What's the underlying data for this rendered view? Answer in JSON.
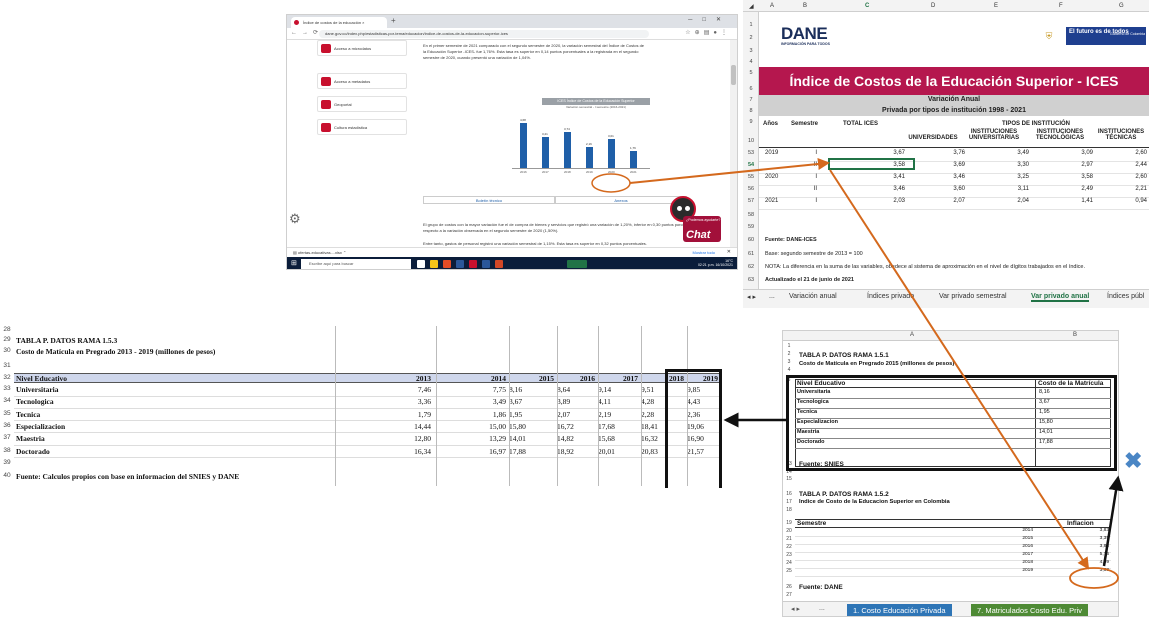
{
  "browser": {
    "tab_title": "Índice de costos de la educación ×",
    "new_tab": "+",
    "url": "dane.gov.co/index.php/estadisticas-por-tema/educacion/indice-de-costos-de-la-educacion-superior-ices",
    "sidebar_items": [
      "Acceso a microdatos",
      "Acceso a metadatos",
      "Geoportal",
      "Cultura estadística"
    ],
    "intro_text": "En el primer semestre de 2021 comparado con el segundo semestre de 2020, la variación semestral del Índice de Costos de la Educación Superior -ICES- fue 1,76%. Esta tasa es superior en 0,14 puntos porcentuales a la registrada en el segundo semestre de 2020, cuando presentó una variación de 1,04%.",
    "chart_title": "ICES Índice de Costos de la Educación Superior",
    "chart_subtitle": "Variación semestral - I semestre (2016-2021)",
    "tab_boletin": "Boletín técnico",
    "tab_anexos": "Anexos",
    "paragraph": "El grupo de costos con la mayor variación fue el de compra de bienes y servicios que registró una variación de 1,20%, inferior en 0,30 puntos porcentuales con respecto a la variación observada en el segundo semestre de 2020 (1,50%).",
    "paragraph2": "Entre tanto, gastos de personal registró una variación semestral de 1,15%. Esta tasa es superior en 0,32 puntos porcentuales.",
    "chat_question": "¿Podemos ayudarte?",
    "chat_label": "Chat",
    "download_file": "ofertas-educativas....xlsx",
    "download_show_all": "Mostrar todo",
    "taskbar_search": "Escribe aquí para buscar",
    "tray_text": "16°C",
    "clock": "02:21 p.m. 16/10/2021"
  },
  "mini_chart": {
    "type": "bar",
    "categories": [
      "2016",
      "2017",
      "2018",
      "2019",
      "2020",
      "2021"
    ],
    "values": [
      4.68,
      3.21,
      3.74,
      2.16,
      3.01,
      1.76
    ]
  },
  "xl1": {
    "columns": [
      "A",
      "B",
      "C",
      "D",
      "E",
      "F",
      "G"
    ],
    "logo": "DANE",
    "logo_sub": "INFORMACIÓN PARA TODOS",
    "gov_text": "El futuro es de todos",
    "gov_sub": "Gobierno de Colombia",
    "title": "Índice de Costos de la Educación Superior - ICES",
    "subtitle1": "Variación Anual",
    "subtitle2": "Privada por tipos de institución 1998 - 2021",
    "headers": {
      "anios": "Años",
      "semestre": "Semestre",
      "total": "TOTAL ICES",
      "tipos": "TIPOS DE INSTITUCIÓN",
      "univ": "UNIVERSIDADES",
      "inst_univ": "INSTITUCIONES UNIVERSITARIAS",
      "inst_tec": "INSTITUCIONES TECNOLÓGICAS",
      "inst_tecn": "INSTITUCIONES TÉCNICAS"
    },
    "rows": [
      {
        "row": "53",
        "year": "2019",
        "sem": "I",
        "vals": [
          "3,67",
          "3,76",
          "3,49",
          "3,09",
          "2,60"
        ]
      },
      {
        "row": "54",
        "year": "",
        "sem": "II",
        "vals": [
          "3,58",
          "3,69",
          "3,30",
          "2,97",
          "2,44"
        ]
      },
      {
        "row": "55",
        "year": "2020",
        "sem": "I",
        "vals": [
          "3,41",
          "3,46",
          "3,25",
          "3,58",
          "2,60"
        ]
      },
      {
        "row": "56",
        "year": "",
        "sem": "II",
        "vals": [
          "3,46",
          "3,60",
          "3,11",
          "2,49",
          "2,21"
        ]
      },
      {
        "row": "57",
        "year": "2021",
        "sem": "I",
        "vals": [
          "2,03",
          "2,07",
          "2,04",
          "1,41",
          "0,94"
        ]
      }
    ],
    "notes": [
      "Fuente: DANE-ICES",
      "Base: segundo semestre de 2013 = 100",
      "NOTA: La diferencia en la suma de las variables, obedece al sistema de aproximación en el nivel  de dígitos trabajados en el índice.",
      "Actualizado el 21 de junio de 2021"
    ],
    "sheets": [
      "...",
      "Variación anual",
      "Índices privado",
      "Var privado semestral",
      "Var privado anual",
      "Índices públ"
    ]
  },
  "xl2": {
    "title": "TABLA P. DATOS RAMA 1.5.3",
    "subtitle": "Costo de Matícula en Pregrado 2013 - 2019 (millones de pesos)",
    "header": "Nivel Educativo",
    "years": [
      "2013",
      "2014",
      "2015",
      "2016",
      "2017",
      "2018",
      "2019"
    ],
    "rows": [
      {
        "row": "33",
        "name": "Universitaria",
        "vals": [
          "7,46",
          "7,75",
          "8,16",
          "8,64",
          "9,14",
          "9,51",
          "9,85"
        ]
      },
      {
        "row": "34",
        "name": "Tecnologica",
        "vals": [
          "3,36",
          "3,49",
          "3,67",
          "3,89",
          "4,11",
          "4,28",
          "4,43"
        ]
      },
      {
        "row": "35",
        "name": "Tecnica",
        "vals": [
          "1,79",
          "1,86",
          "1,95",
          "2,07",
          "2,19",
          "2,28",
          "2,36"
        ]
      },
      {
        "row": "36",
        "name": "Especializacion",
        "vals": [
          "14,44",
          "15,00",
          "15,80",
          "16,72",
          "17,68",
          "18,41",
          "19,06"
        ]
      },
      {
        "row": "37",
        "name": "Maestria",
        "vals": [
          "12,80",
          "13,29",
          "14,01",
          "14,82",
          "15,68",
          "16,32",
          "16,90"
        ]
      },
      {
        "row": "38",
        "name": "Doctorado",
        "vals": [
          "16,34",
          "16,97",
          "17,88",
          "18,92",
          "20,01",
          "20,83",
          "21,57"
        ]
      }
    ],
    "source": "Fuente: Calculos propios con base en informacion del SNIES y DANE"
  },
  "xl3": {
    "title1": "TABLA P. DATOS RAMA 1.5.1",
    "sub1": "Costo de Matícula en Pregrado 2015 (millones de pesos)",
    "hdr_nivel": "Nivel Educativo",
    "hdr_costo": "Costo de la Matrícula",
    "rows": [
      {
        "name": "Universitaria",
        "val": "8,16"
      },
      {
        "name": "Tecnologica",
        "val": "3,67"
      },
      {
        "name": "Tecnica",
        "val": "1,95"
      },
      {
        "name": "Especializacion",
        "val": "15,80"
      },
      {
        "name": "Maestria",
        "val": "14,01"
      },
      {
        "name": "Doctorado",
        "val": "17,88"
      }
    ],
    "source1": "Fuente: SNIES",
    "title2": "TABLA P. DATOS RAMA 1.5.2",
    "sub2": "Indice de Costo de la Educacion Superior en Colombia",
    "hdr_sem": "Semestre",
    "hdr_infl": "Inflacion",
    "sem_rows": [
      {
        "sem": "2014",
        "val": "3,83"
      },
      {
        "sem": "2015",
        "val": "3,35"
      },
      {
        "sem": "2016",
        "val": "3,83"
      },
      {
        "sem": "2017",
        "val": "5,76"
      },
      {
        "sem": "2018",
        "val": "4,09"
      },
      {
        "sem": "2019",
        "val": "3,58"
      }
    ],
    "source2": "Fuente: DANE",
    "tabs": [
      "...",
      "1. Costo Educación Privada",
      "7. Matriculados Costo Edu. Priv"
    ]
  },
  "colors": {
    "dane_magenta": "#b5174e",
    "excel_green": "#217346",
    "arrow_orange": "#d4691d",
    "tab_blue": "#2e75b6",
    "tab_green": "#4e8a35"
  }
}
